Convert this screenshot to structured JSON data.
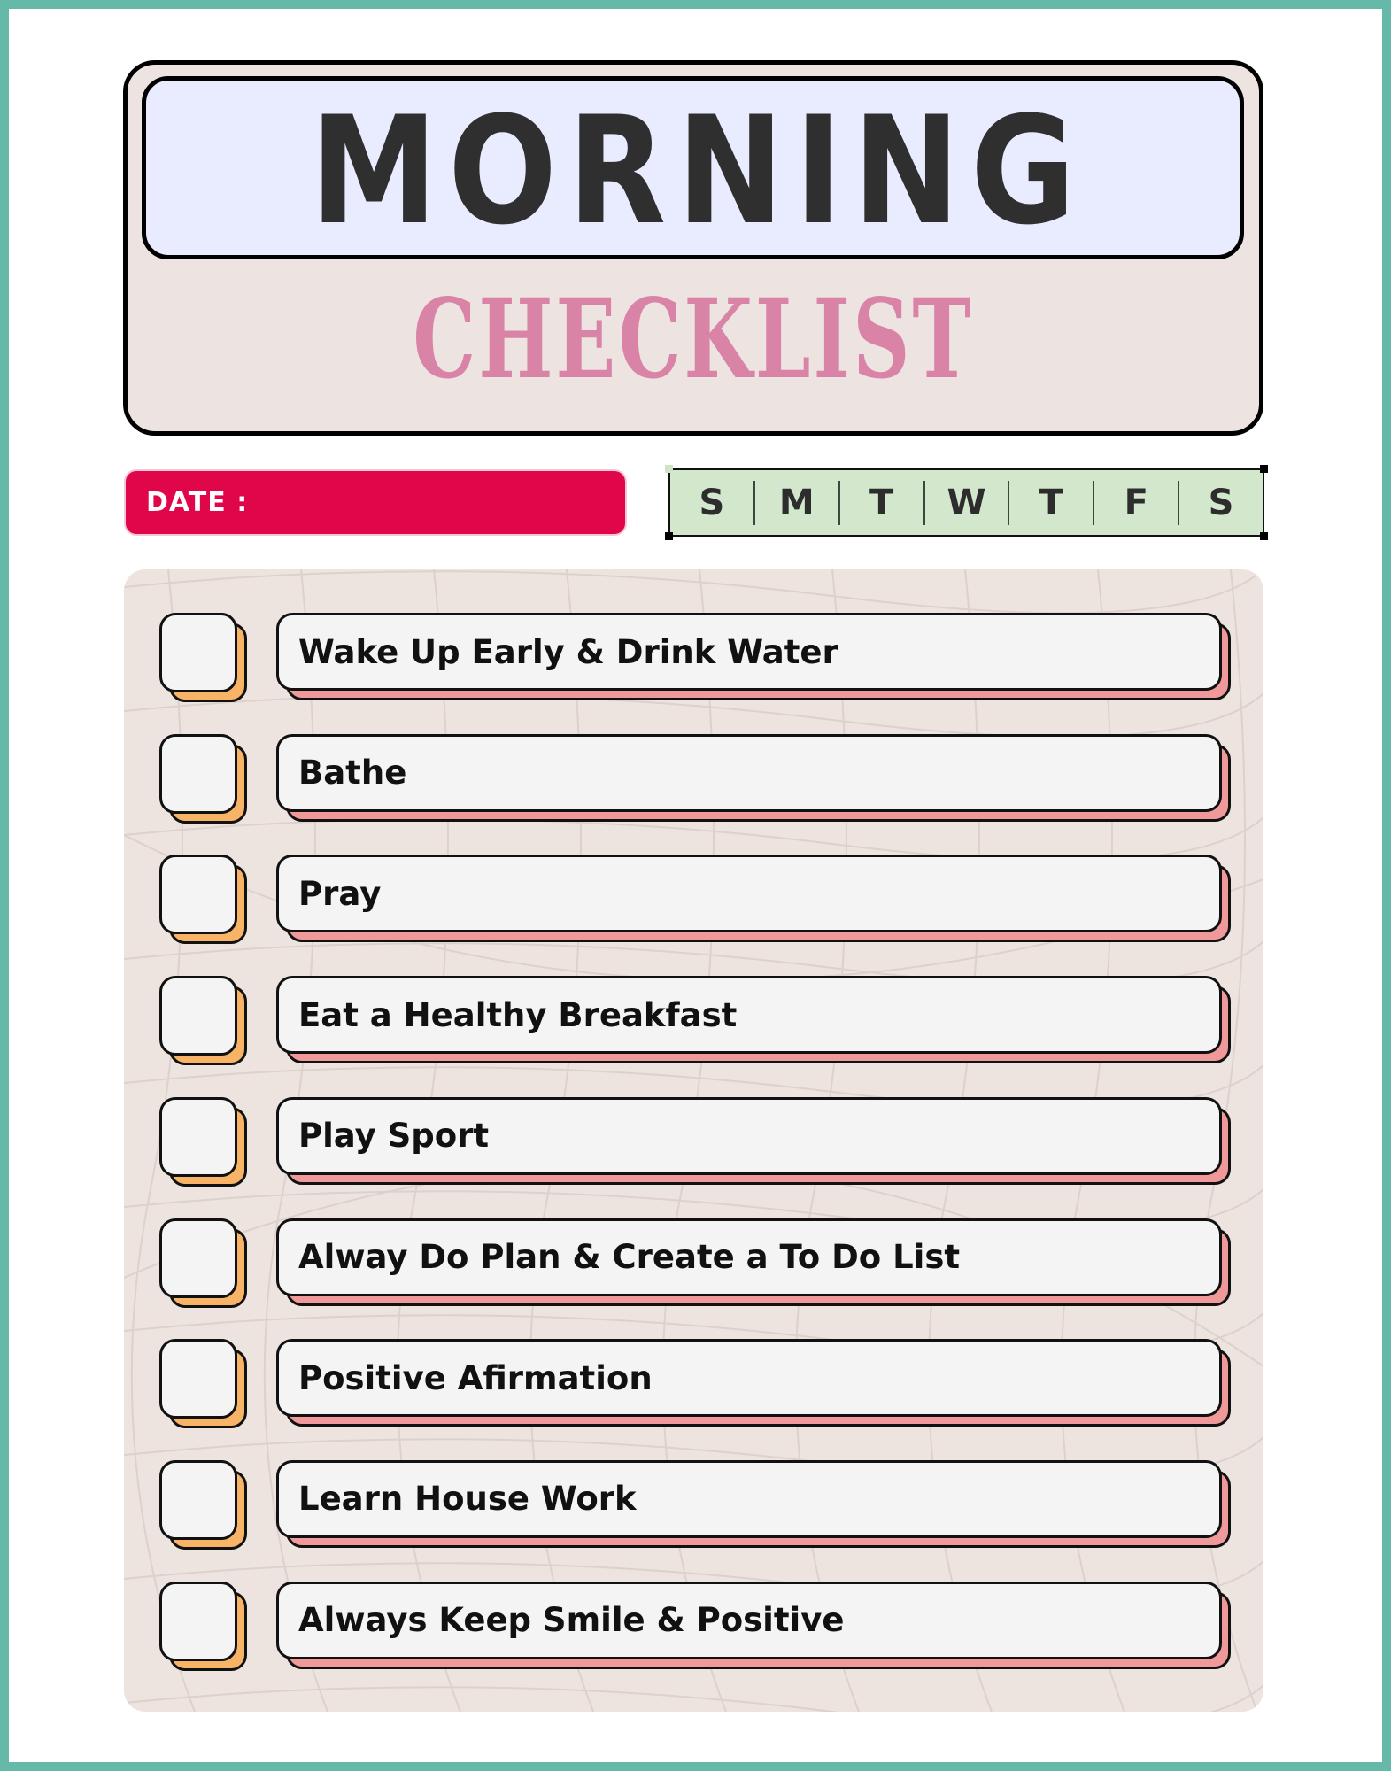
{
  "title": {
    "main": "MORNING",
    "sub": "CHECKLIST"
  },
  "date": {
    "label": "DATE :",
    "value": ""
  },
  "weekdays": [
    "S",
    "M",
    "T",
    "W",
    "T",
    "F",
    "S"
  ],
  "tasks": [
    {
      "label": "Wake Up Early & Drink Water",
      "checked": false
    },
    {
      "label": "Bathe",
      "checked": false
    },
    {
      "label": "Pray",
      "checked": false
    },
    {
      "label": "Eat a Healthy Breakfast",
      "checked": false
    },
    {
      "label": "Play Sport",
      "checked": false
    },
    {
      "label": "Alway Do Plan & Create a To Do List",
      "checked": false
    },
    {
      "label": "Positive Afirmation",
      "checked": false
    },
    {
      "label": "Learn House Work",
      "checked": false
    },
    {
      "label": "Always Keep Smile & Positive",
      "checked": false
    }
  ],
  "colors": {
    "frame": "#66b8a8",
    "header_bg": "#ede3e0",
    "title_box_bg": "#e8ecfe",
    "title_text": "#2f2f2f",
    "subtitle_text": "#d984a6",
    "date_bar": "#e0064a",
    "weekday_bg": "#d3e7cc",
    "panel_bg": "#ede3df",
    "checkbox_shadow": "#f7b366",
    "label_shadow": "#f0999a"
  }
}
